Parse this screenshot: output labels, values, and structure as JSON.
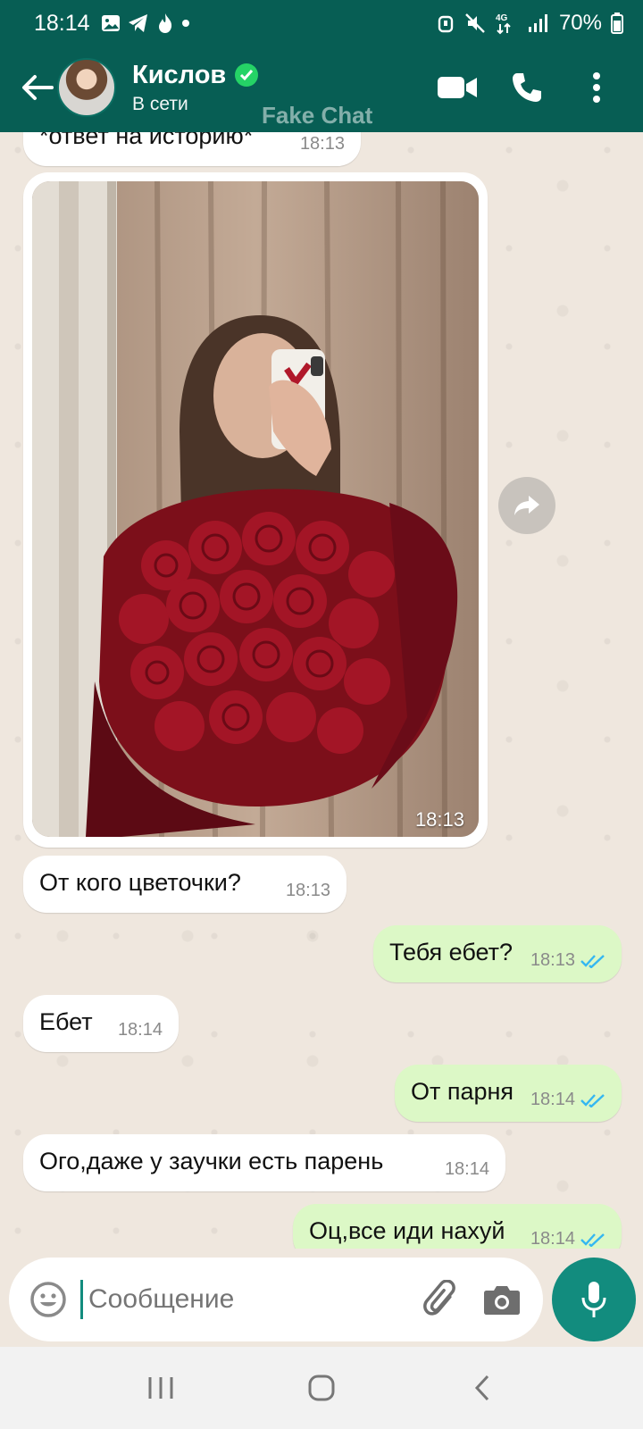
{
  "status_bar": {
    "time": "18:14",
    "battery": "70%",
    "network": "4G"
  },
  "header": {
    "contact_name": "Кислов",
    "presence": "В сети",
    "watermark": "Fake Chat"
  },
  "messages": [
    {
      "direction": "in",
      "text": "*ответ на историю*",
      "time": "18:13"
    },
    {
      "direction": "in",
      "type": "photo",
      "time": "18:13"
    },
    {
      "direction": "in",
      "text": "От кого цветочки?",
      "time": "18:13"
    },
    {
      "direction": "out",
      "text": "Тебя ебет?",
      "time": "18:13",
      "status": "read"
    },
    {
      "direction": "in",
      "text": "Ебет",
      "time": "18:14"
    },
    {
      "direction": "out",
      "text": "От парня",
      "time": "18:14",
      "status": "read"
    },
    {
      "direction": "in",
      "text": "Ого,даже у заучки есть парень",
      "time": "18:14"
    },
    {
      "direction": "out",
      "text": "Оц,все иди нахуй",
      "time": "18:14",
      "status": "read"
    }
  ],
  "composer": {
    "placeholder": "Сообщение"
  },
  "colors": {
    "header": "#075e54",
    "outgoing_bubble": "#dcf8c6",
    "incoming_bubble": "#ffffff",
    "read_ticks": "#34b7f1",
    "mic_button": "#128c7e"
  },
  "icons": [
    "back-arrow-icon",
    "verified-icon",
    "video-call-icon",
    "phone-icon",
    "more-vert-icon",
    "forward-icon",
    "emoji-icon",
    "attach-icon",
    "camera-icon",
    "mic-icon",
    "recents-icon",
    "home-icon",
    "back-nav-icon"
  ]
}
